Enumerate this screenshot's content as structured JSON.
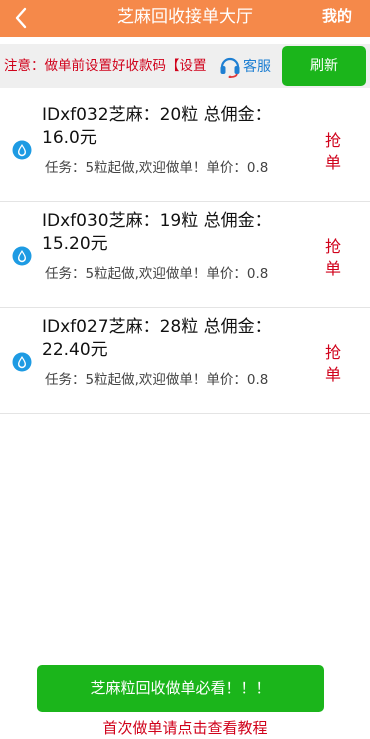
{
  "header": {
    "title": "芝麻回收接单大厅",
    "mine_label": "我的",
    "back_icon": "chevron-left-icon",
    "color": "#f5894a"
  },
  "notice": {
    "text": "注意：做单前设置好收款码【设置",
    "service_label": "客服",
    "service_icon": "headset-icon",
    "refresh_label": "刷新"
  },
  "orders": [
    {
      "title": "IDxf032芝麻：20粒 总佣金：16.0元",
      "task": "任务：5粒起做,欢迎做单！单价：0.8",
      "grab_label": "抢单",
      "icon": "water-drop-icon"
    },
    {
      "title": "IDxf030芝麻：19粒 总佣金：15.20元",
      "task": "任务：5粒起做,欢迎做单！单价：0.8",
      "grab_label": "抢单",
      "icon": "water-drop-icon"
    },
    {
      "title": "IDxf027芝麻：28粒 总佣金：22.40元",
      "task": "任务：5粒起做,欢迎做单！单价：0.8",
      "grab_label": "抢单",
      "icon": "water-drop-icon"
    }
  ],
  "footer": {
    "guide_label": "芝麻粒回收做单必看！！！",
    "tutorial_label": "首次做单请点击查看教程"
  },
  "colors": {
    "accent": "#f5894a",
    "button_green": "#1bb51b",
    "alert_red": "#d0021b",
    "link_blue": "#1e7fd2"
  }
}
